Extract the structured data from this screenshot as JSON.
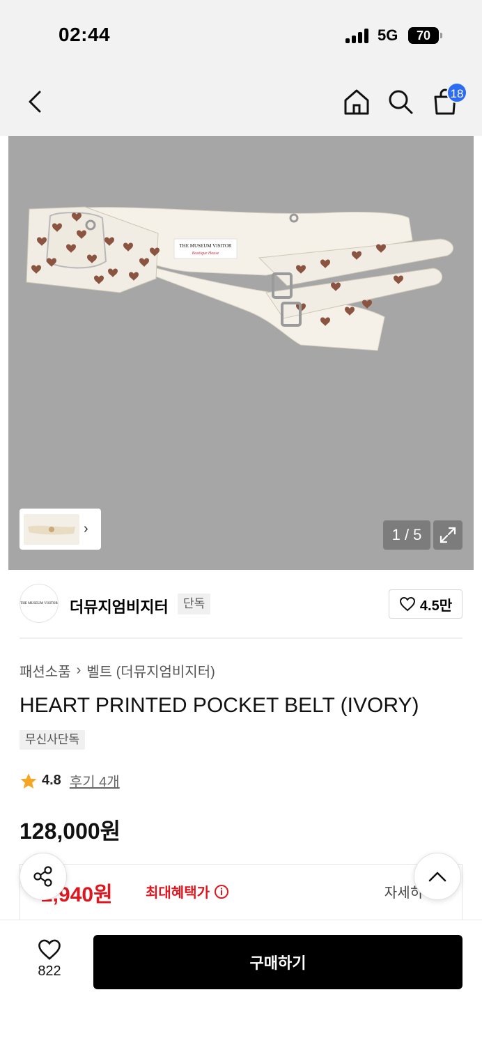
{
  "status_bar": {
    "time": "02:44",
    "network": "5G",
    "battery": "70"
  },
  "nav": {
    "back_icon": "chevron-left-icon",
    "home_icon": "home-icon",
    "search_icon": "search-icon",
    "cart_icon": "shopping-bag-icon",
    "cart_count": "18"
  },
  "gallery": {
    "counter": "1 / 5",
    "product_label_line1": "THE MUSEUM VISITOR",
    "product_label_line2": "Boutique House",
    "colors": {
      "background": "#a6a6a6",
      "belt": "#f5f1e8",
      "heart": "#8a5440"
    }
  },
  "brand": {
    "logo_text": "THE MUSEUM VISITOR",
    "name": "더뮤지엄비지터",
    "tag": "단독",
    "likes": "4.5만"
  },
  "product": {
    "breadcrumb": [
      "패션소품",
      "벨트 (더뮤지엄비지터)"
    ],
    "title": "HEART PRINTED POCKET BELT (IVORY)",
    "exclusive_tag": "무신사단독",
    "rating": "4.8",
    "review_link": "후기 4개",
    "price": "128,000원"
  },
  "benefit": {
    "price": "2,940원",
    "label": "최대혜택가",
    "detail": "자세히",
    "accent": "#e0161e"
  },
  "bottom": {
    "like_count": "822",
    "buy_label": "구매하기"
  }
}
